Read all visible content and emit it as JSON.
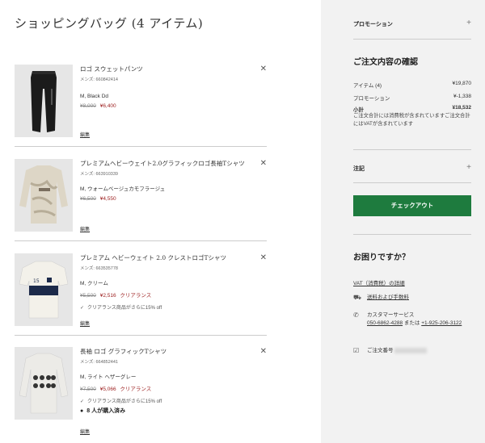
{
  "title": "ショッピングバッグ (4 アイテム)",
  "items": [
    {
      "name": "ロゴ スウェットパンツ",
      "code": "メンズ: 660842414",
      "variant": "M, Black Dd",
      "old_price": "¥8,000",
      "new_price": "¥6,400",
      "tag": "",
      "note": "",
      "edit": "編集",
      "image": "black-sweatpants"
    },
    {
      "name": "プレミアムヘビーウェイト2.0グラフィックロゴ長袖Tシャツ",
      "code": "メンズ: 663910339",
      "variant": "M, ウォームベージュカモフラージュ",
      "old_price": "¥6,500",
      "new_price": "¥4,550",
      "tag": "",
      "note": "",
      "edit": "編集",
      "image": "camo-long-sleeve-tee"
    },
    {
      "name": "プレミアム ヘビーウェイト 2.0 クレストロゴTシャツ",
      "code": "メンズ: 663535778",
      "variant": "M, クリーム",
      "old_price": "¥5,500",
      "new_price": "¥2,516",
      "tag": "クリアランス",
      "note": "クリアランス商品がさらに15% off",
      "edit": "編集",
      "image": "cream-crest-tee"
    },
    {
      "name": "長袖 ロゴ グラフィックTシャツ",
      "code": "メンズ: 664852441",
      "variant": "M, ライト ヘザーグレー",
      "old_price": "¥7,500",
      "new_price": "¥5,066",
      "tag": "クリアランス",
      "note": "クリアランス商品がさらに15% off",
      "buying": "8 人が購入済み",
      "edit": "編集",
      "image": "grey-graphic-long-sleeve"
    }
  ],
  "sidebar": {
    "promotion": "プロモーション",
    "summary_title": "ご注文内容の確認",
    "rows": [
      {
        "label": "アイテム (4)",
        "value": "¥19,870"
      },
      {
        "label": "プロモーション",
        "value": "¥-1,338"
      },
      {
        "label": "小計",
        "value": "¥18,532"
      }
    ],
    "tax_note": "ご注文合計には消費税が含まれていますご注文合計にはVATが含まれています",
    "notes_label": "注記",
    "checkout": "チェックアウト",
    "help_title": "お困りですか？",
    "vat_link": "VAT（消費税）の詳細",
    "shipping": "送料および手数料",
    "customer_service": "カスタマーサービス",
    "phone1": "050-6862-4288",
    "or": "または",
    "phone2": "+1-925-206-3122",
    "order_no": "ご注文番号"
  },
  "colors": {
    "accent": "#1e7b3e",
    "sale": "#9b1c1c",
    "sidebar_bg": "#f2f2f2"
  }
}
